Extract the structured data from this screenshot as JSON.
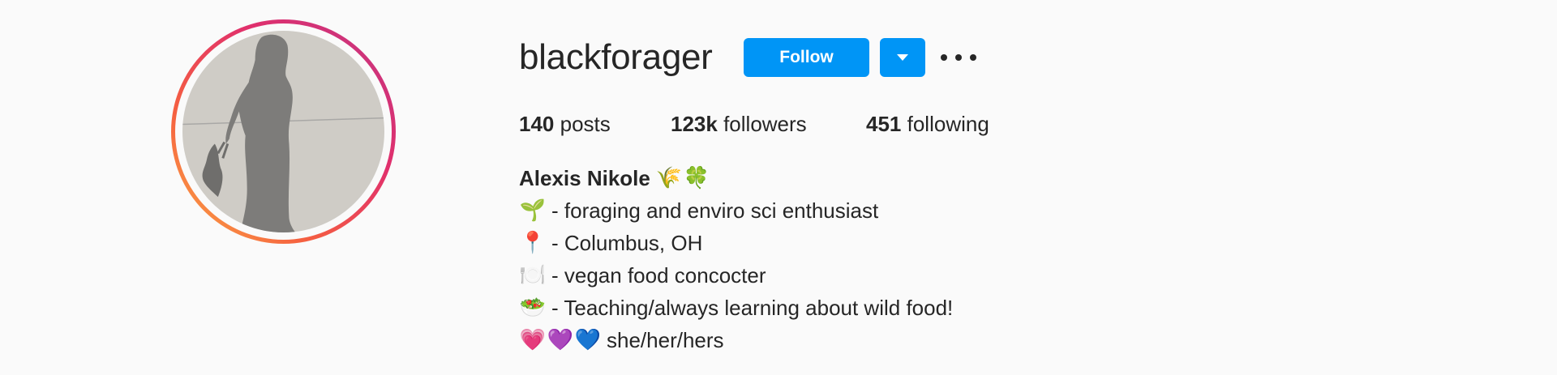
{
  "profile": {
    "username": "blackforager",
    "follow_label": "Follow",
    "dropdown_icon": "caret-down-icon",
    "more_icon": "ellipsis-icon"
  },
  "stats": {
    "posts_count": "140",
    "posts_label": "posts",
    "followers_count": "123k",
    "followers_label": "followers",
    "following_count": "451",
    "following_label": "following"
  },
  "bio": {
    "full_name": "Alexis Nikole",
    "name_emojis": [
      "🌾",
      "🍀"
    ],
    "lines": [
      {
        "emoji": "🌱",
        "text": "- foraging and enviro sci enthusiast"
      },
      {
        "emoji": "📍",
        "text": "- Columbus, OH"
      },
      {
        "emoji": "🍽️",
        "text": "- vegan food concocter"
      },
      {
        "emoji": "🥗",
        "text": "- Teaching/always learning about wild food!"
      }
    ],
    "pronoun_emojis": [
      "💗",
      "💜",
      "💙"
    ],
    "pronouns": "she/her/hers"
  },
  "colors": {
    "accent": "#0095f6",
    "text": "#262626",
    "background": "#fafafa",
    "ring_gradient": [
      "#c13584",
      "#e1306c",
      "#f56040",
      "#fcaf45"
    ]
  }
}
